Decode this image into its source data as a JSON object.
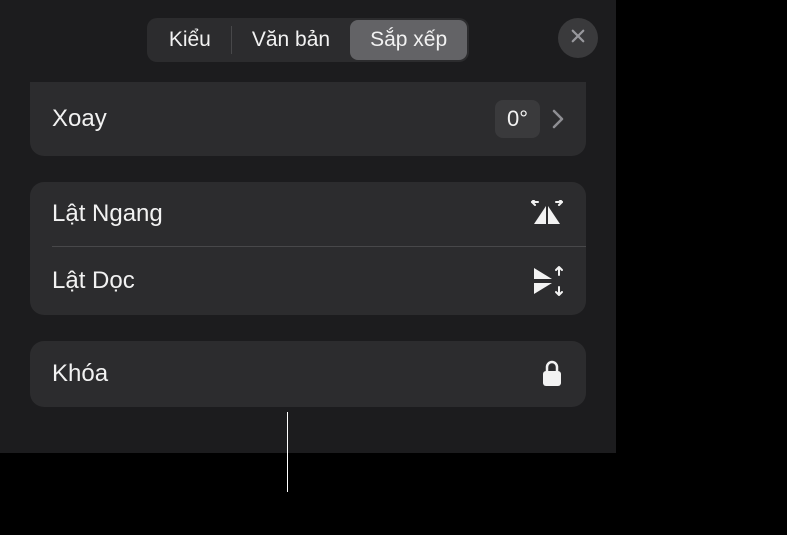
{
  "header": {
    "tabs": {
      "style": "Kiểu",
      "text": "Văn bản",
      "arrange": "Sắp xếp"
    }
  },
  "rotate": {
    "label": "Xoay",
    "value": "0°"
  },
  "flip": {
    "horizontal": "Lật Ngang",
    "vertical": "Lật Dọc"
  },
  "lock": {
    "label": "Khóa"
  }
}
